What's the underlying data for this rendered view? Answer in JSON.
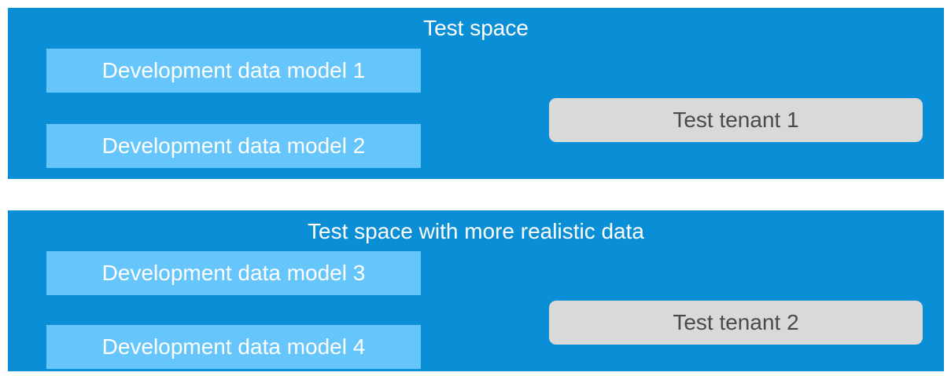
{
  "spaces": [
    {
      "title": "Test space",
      "models": [
        "Development data model 1",
        "Development data model 2"
      ],
      "tenant": "Test tenant 1"
    },
    {
      "title": "Test space with more realistic data",
      "models": [
        "Development data model 3",
        "Development data model 4"
      ],
      "tenant": "Test tenant 2"
    }
  ],
  "colors": {
    "space_background": "#0a8fd6",
    "model_background": "#66c6fb",
    "tenant_background": "#d9d9d9",
    "tenant_text": "#4a4a4a"
  }
}
